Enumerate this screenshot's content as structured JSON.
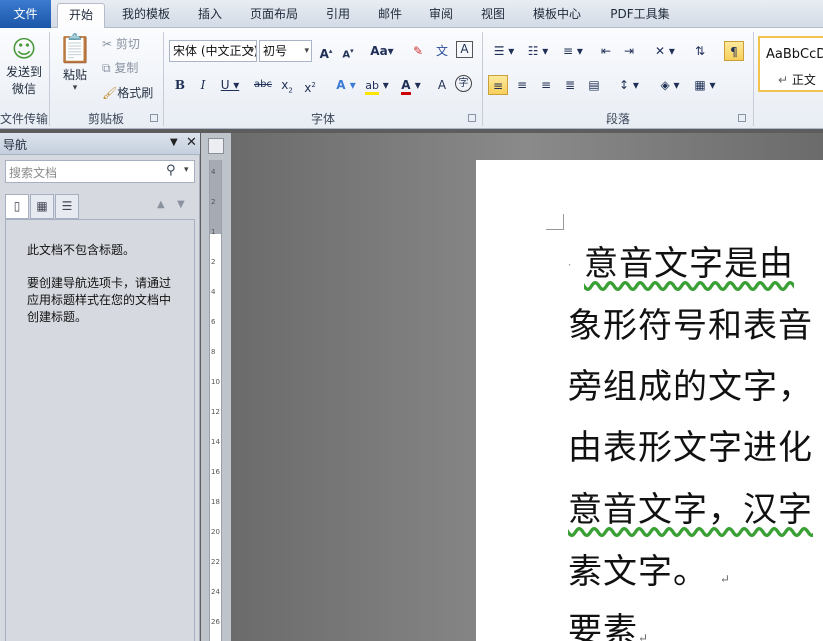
{
  "tabs": [
    {
      "label": "文件"
    },
    {
      "label": "开始"
    },
    {
      "label": "我的模板"
    },
    {
      "label": "插入"
    },
    {
      "label": "页面布局"
    },
    {
      "label": "引用"
    },
    {
      "label": "邮件"
    },
    {
      "label": "审阅"
    },
    {
      "label": "视图"
    },
    {
      "label": "模板中心"
    },
    {
      "label": "PDF工具集"
    }
  ],
  "ribbon": {
    "send_wechat": "发送到\n微信",
    "paste": "粘贴",
    "cut": "剪切",
    "copy": "复制",
    "format_painter": "格式刷",
    "font_name": "宋体 (中文正文)",
    "font_size": "初号",
    "style_sample": "AaBbCcD",
    "style_name": "正文",
    "groups": {
      "file_transfer": "文件传输",
      "clipboard": "剪贴板",
      "font": "字体",
      "paragraph": "段落"
    }
  },
  "nav": {
    "title": "导航",
    "search_placeholder": "搜索文档",
    "no_headings": "此文档不包含标题。",
    "instructions": "要创建导航选项卡，请通过应用标题样式在您的文档中创建标题。"
  },
  "ruler": {
    "marks": [
      "4",
      "2",
      "1",
      "2",
      "4",
      "6",
      "8",
      "10",
      "12",
      "14",
      "16",
      "18",
      "20",
      "22",
      "24",
      "26"
    ]
  },
  "document": {
    "lines": [
      "意音文字是由",
      "象形符号和表音",
      "旁组成的文字，",
      "由表形文字进化",
      "意音文字，汉字",
      "素文字。",
      "要素"
    ]
  }
}
